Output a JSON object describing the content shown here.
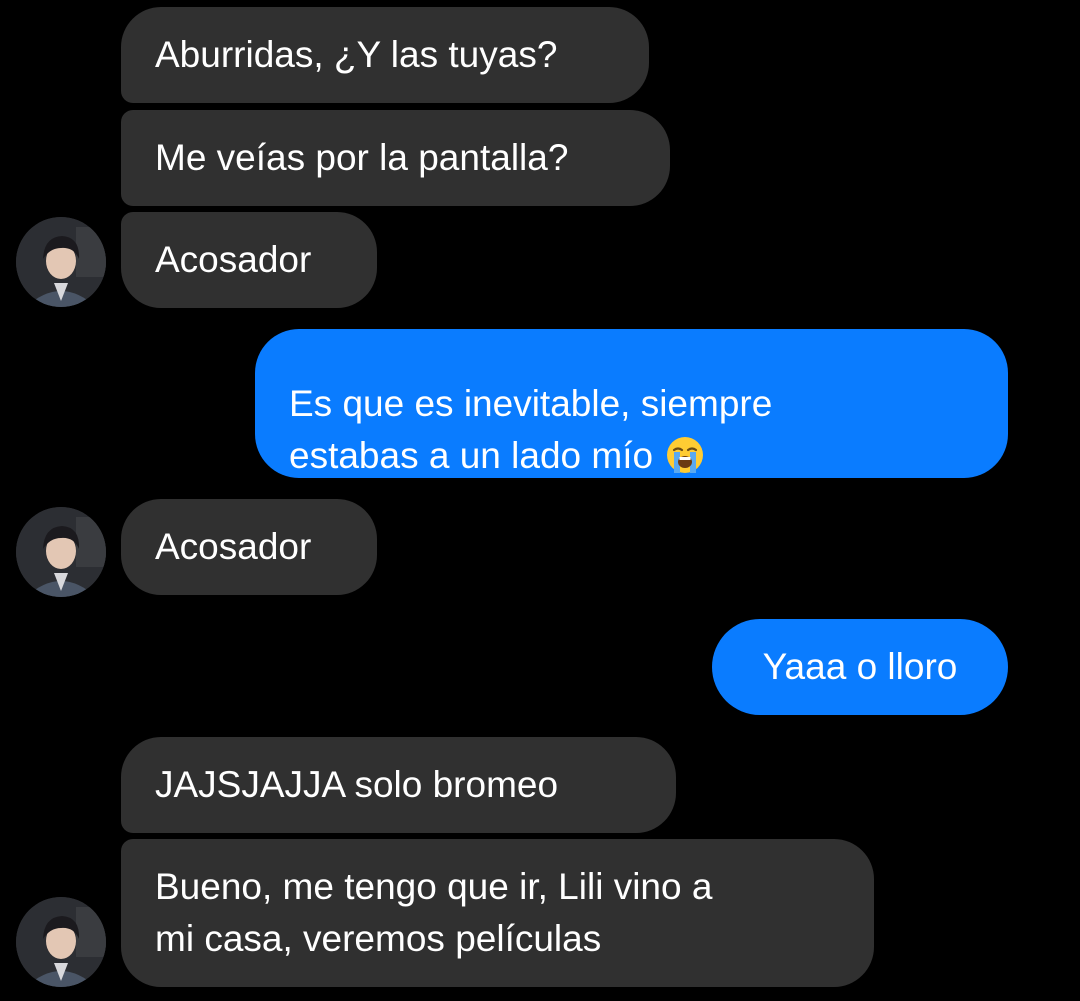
{
  "conversation": {
    "messages": [
      {
        "from": "contact",
        "text": "Aburridas, ¿Y las tuyas?"
      },
      {
        "from": "contact",
        "text": "Me veías por la pantalla?"
      },
      {
        "from": "contact",
        "text": "Acosador"
      },
      {
        "from": "me",
        "text": "Es que es inevitable, siempre\nestabas a un lado mío",
        "emoji": "loudly-crying-face"
      },
      {
        "from": "contact",
        "text": "Acosador"
      },
      {
        "from": "me",
        "text": "Yaaa o lloro"
      },
      {
        "from": "contact",
        "text": "JAJSJAJJA solo bromeo"
      },
      {
        "from": "contact",
        "text": "Bueno, me tengo que ir, Lili vino a\nmi casa, veremos películas"
      }
    ]
  },
  "colors": {
    "background": "#000000",
    "incoming_bubble": "#303030",
    "outgoing_bubble": "#0A7CFF",
    "text": "#FFFFFF"
  }
}
